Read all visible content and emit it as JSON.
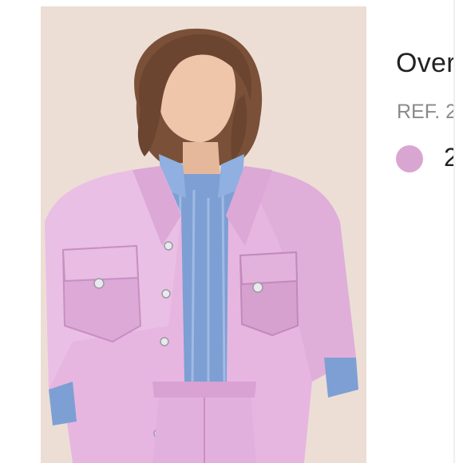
{
  "product": {
    "image_subject": "product-photo",
    "title": "Over",
    "ref": "REF. 2",
    "color_count": "2",
    "swatch_color": "#d9a6d2"
  }
}
